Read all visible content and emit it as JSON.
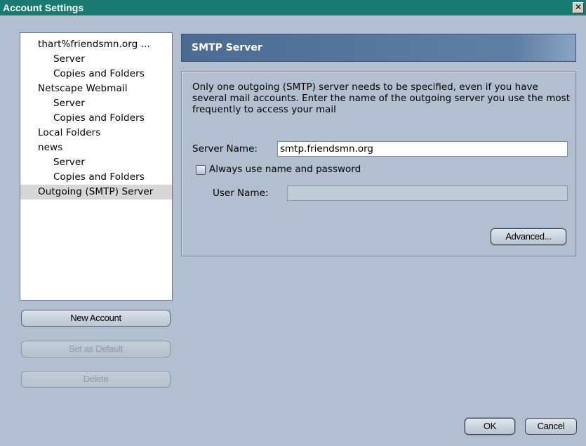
{
  "window": {
    "title": "Account Settings",
    "close_glyph": "✕"
  },
  "tree": {
    "items": [
      {
        "label": "thart%friendsmn.org ...",
        "level": 0
      },
      {
        "label": "Server",
        "level": 1
      },
      {
        "label": "Copies and Folders",
        "level": 1
      },
      {
        "label": "Netscape Webmail",
        "level": 0
      },
      {
        "label": "Server",
        "level": 1
      },
      {
        "label": "Copies and Folders",
        "level": 1
      },
      {
        "label": "Local Folders",
        "level": 0
      },
      {
        "label": "news",
        "level": 0
      },
      {
        "label": "Server",
        "level": 1
      },
      {
        "label": "Copies and Folders",
        "level": 1
      },
      {
        "label": "Outgoing (SMTP) Server",
        "level": 0,
        "selected": true
      }
    ]
  },
  "buttons": {
    "new_account": "New Account",
    "set_default": "Set as Default",
    "delete": "Delete",
    "advanced": "Advanced...",
    "ok": "OK",
    "cancel": "Cancel"
  },
  "panel": {
    "title": "SMTP Server",
    "description": "Only one outgoing (SMTP) server needs to be specified, even if you have several mail accounts. Enter the name of the outgoing server you use the most frequently to access your mail",
    "server_name_label": "Server Name:",
    "server_name_value": "smtp.friendsmn.org",
    "always_use_label": "Always use name and password",
    "always_use_checked": false,
    "user_name_label": "User Name:",
    "user_name_value": ""
  },
  "colors": {
    "titlebar": "#1a7a72",
    "background": "#b1bfd0",
    "header": "#4c6b92",
    "selection": "#d7d7d7"
  }
}
